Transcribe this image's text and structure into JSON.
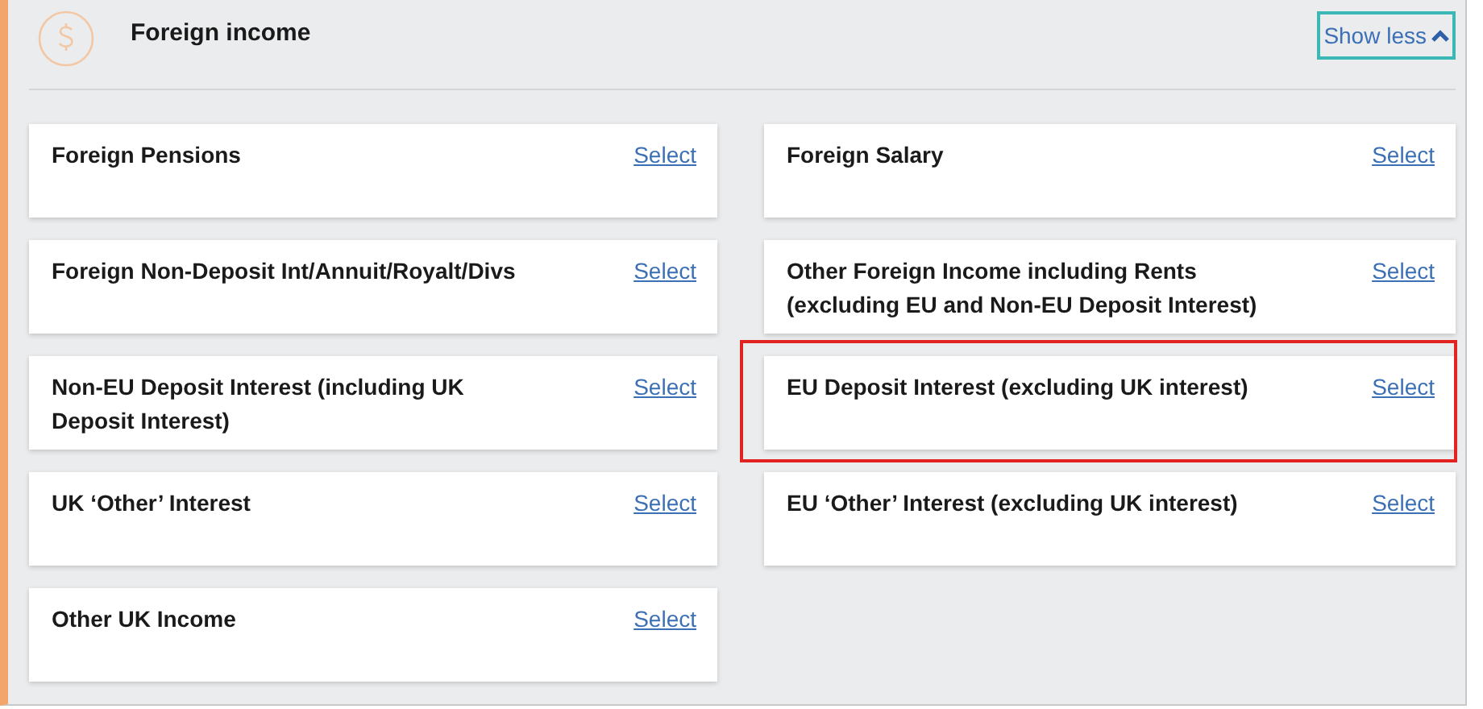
{
  "section": {
    "title": "Foreign income",
    "toggle": {
      "label": "Show less",
      "focused": true,
      "expanded": true
    }
  },
  "items": [
    {
      "label": "Foreign Pensions",
      "action": "Select",
      "highlighted": false
    },
    {
      "label": "Foreign Salary",
      "action": "Select",
      "highlighted": false
    },
    {
      "label": "Foreign Non-Deposit Int/Annuit/Royalt/Divs",
      "action": "Select",
      "highlighted": false
    },
    {
      "label": "Other Foreign Income including Rents (excluding EU and Non-EU Deposit Interest)",
      "action": "Select",
      "highlighted": false
    },
    {
      "label": "Non-EU Deposit Interest (including UK Deposit Interest)",
      "action": "Select",
      "highlighted": false
    },
    {
      "label": "EU Deposit Interest (excluding UK interest)",
      "action": "Select",
      "highlighted": true
    },
    {
      "label": "UK ‘Other’ Interest",
      "action": "Select",
      "highlighted": false
    },
    {
      "label": "EU ‘Other’ Interest (excluding UK interest)",
      "action": "Select",
      "highlighted": false
    },
    {
      "label": "Other UK Income",
      "action": "Select",
      "highlighted": false
    }
  ]
}
